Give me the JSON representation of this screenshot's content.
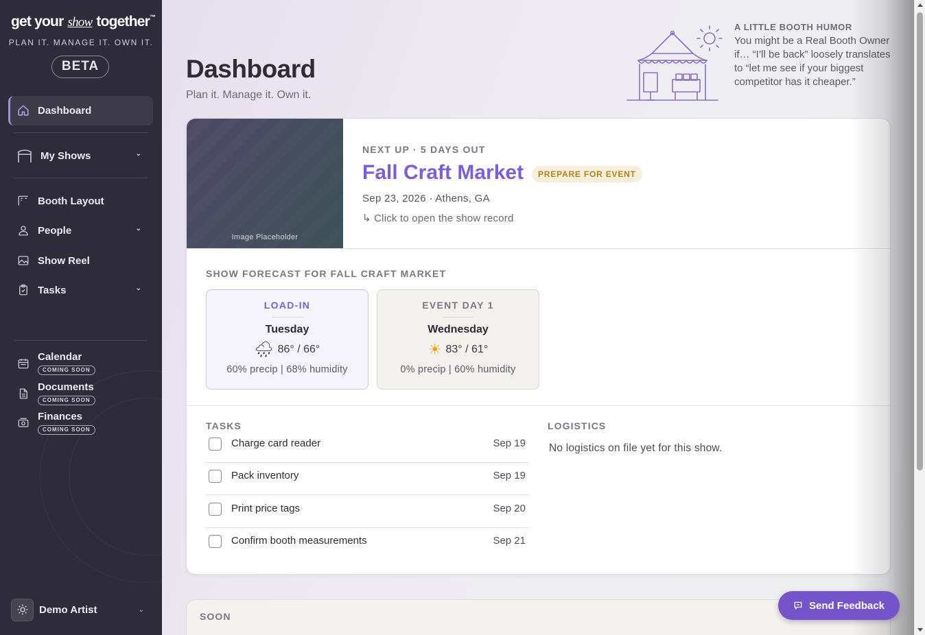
{
  "brand": {
    "logo_pre": "get your",
    "logo_show": "show",
    "logo_post": "together",
    "logo_tm": "™",
    "tagline": "PLAN IT. MANAGE IT. OWN IT.",
    "beta": "BETA"
  },
  "sidebar": {
    "items": [
      {
        "label": "Dashboard",
        "icon": "home-icon",
        "active": true
      },
      {
        "label": "My Shows",
        "icon": "tent-icon",
        "has_submenu": true
      },
      {
        "label": "Booth Layout",
        "icon": "layout-icon"
      },
      {
        "label": "People",
        "icon": "person-icon",
        "has_submenu": true
      },
      {
        "label": "Show Reel",
        "icon": "image-icon"
      },
      {
        "label": "Tasks",
        "icon": "clipboard-icon",
        "has_submenu": true
      }
    ],
    "coming_soon": [
      {
        "label": "Calendar",
        "badge": "COMING SOON",
        "icon": "calendar-icon"
      },
      {
        "label": "Documents",
        "badge": "COMING SOON",
        "icon": "document-icon"
      },
      {
        "label": "Finances",
        "badge": "COMING SOON",
        "icon": "money-icon"
      }
    ],
    "user": {
      "name": "Demo Artist",
      "icon": "sun-icon"
    }
  },
  "header": {
    "title": "Dashboard",
    "subtitle": "Plan it. Manage it. Own it."
  },
  "humor": {
    "heading": "A LITTLE BOOTH HUMOR",
    "text": "You might be a Real Booth Owner if… “I’ll be back” loosely translates to “let me see if your biggest competitor has it cheaper.”"
  },
  "next_show": {
    "image_placeholder": "Image Placeholder",
    "eyebrow": "NEXT UP · 5 DAYS OUT",
    "title": "Fall Craft Market",
    "badge": "PREPARE FOR EVENT",
    "meta": "Sep 23, 2026 · Athens, GA",
    "open_hint": "↳ Click to open the show record"
  },
  "forecast": {
    "title": "SHOW FORECAST FOR FALL CRAFT MARKET",
    "days": [
      {
        "label": "LOAD-IN",
        "day": "Tuesday",
        "icon": "rain-cloud-icon",
        "glyph": "🌧",
        "temp": "86° / 66°",
        "details": "60% precip | 68% humidity"
      },
      {
        "label": "EVENT DAY 1",
        "day": "Wednesday",
        "icon": "sun-icon",
        "glyph": "☀",
        "temp": "83° / 61°",
        "details": "0% precip | 60% humidity"
      }
    ]
  },
  "tasks": {
    "title": "TASKS",
    "items": [
      {
        "title": "Charge card reader",
        "date": "Sep 19",
        "done": false
      },
      {
        "title": "Pack inventory",
        "date": "Sep 19",
        "done": false
      },
      {
        "title": "Print price tags",
        "date": "Sep 20",
        "done": false
      },
      {
        "title": "Confirm booth measurements",
        "date": "Sep 21",
        "done": false
      }
    ]
  },
  "logistics": {
    "title": "LOGISTICS",
    "empty": "No logistics on file yet for this show."
  },
  "soon_section": {
    "title": "SOON"
  },
  "feedback_button": {
    "label": "Send Feedback",
    "icon": "chat-bubble-icon"
  },
  "colors": {
    "accent": "#7c5fd8",
    "sidebar": "#2e2c3a",
    "badge_bg": "#f6efdb",
    "badge_text": "#b3841d",
    "feedback": "#7553c9"
  }
}
